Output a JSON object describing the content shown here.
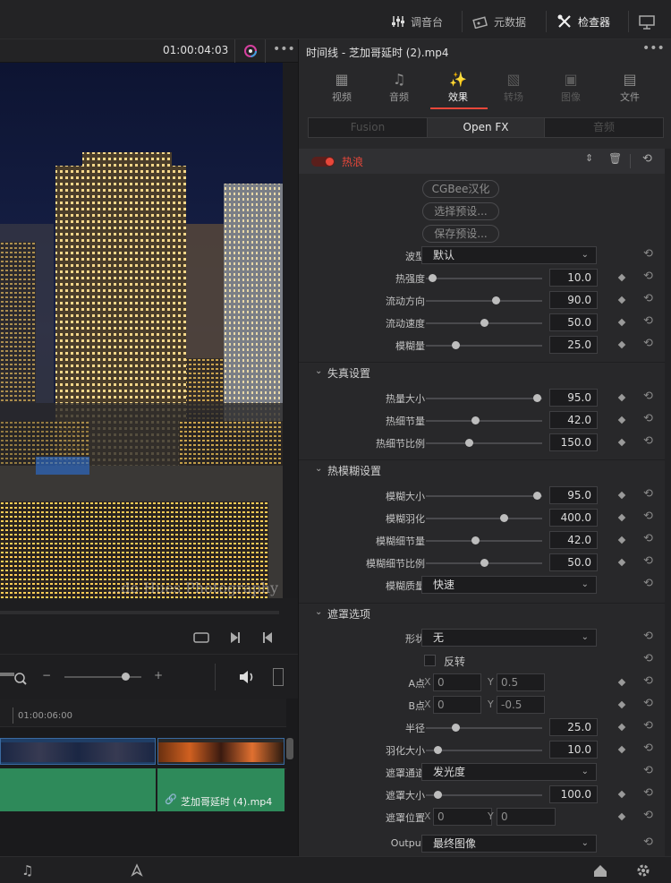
{
  "topbar": {
    "mixer": "调音台",
    "metadata": "元数据",
    "inspector": "检查器"
  },
  "viewer": {
    "timecode": "01:00:04:03",
    "watermark": "...do Hues Photography"
  },
  "timeline": {
    "ruler_time": "01:00:06:00",
    "audio_clip": "芝加哥延时 (4).mp4"
  },
  "inspector": {
    "title": "时间线 - 芝加哥延时 (2).mp4",
    "tabs": [
      {
        "label": "视频",
        "icon": "video-icon"
      },
      {
        "label": "音频",
        "icon": "music-icon"
      },
      {
        "label": "效果",
        "icon": "magic-wand-icon"
      },
      {
        "label": "转场",
        "icon": "transition-icon"
      },
      {
        "label": "图像",
        "icon": "image-icon"
      },
      {
        "label": "文件",
        "icon": "file-icon"
      }
    ],
    "subtabs": [
      "Fusion",
      "Open FX",
      "音频"
    ],
    "effect_name": "热浪",
    "buttons": [
      "CGBee汉化",
      "选择预设...",
      "保存预设..."
    ],
    "params": {
      "wave_type": {
        "label": "波型",
        "value": "默认"
      },
      "heat_strength": {
        "label": "热强度",
        "value": "10.0",
        "fraction": 0.05
      },
      "flow_direction": {
        "label": "流动方向",
        "value": "90.0",
        "fraction": 0.6
      },
      "flow_speed": {
        "label": "流动速度",
        "value": "50.0",
        "fraction": 0.5
      },
      "blur_amount": {
        "label": "模糊量",
        "value": "25.0",
        "fraction": 0.25
      }
    },
    "distortion": {
      "title": "失真设置",
      "heat_size": {
        "label": "热量大小",
        "value": "95.0",
        "fraction": 0.95
      },
      "heat_detail": {
        "label": "热细节量",
        "value": "42.0",
        "fraction": 0.42
      },
      "heat_detail_ratio": {
        "label": "热细节比例",
        "value": "150.0",
        "fraction": 0.37
      }
    },
    "heat_blur": {
      "title": "热模糊设置",
      "blur_size": {
        "label": "模糊大小",
        "value": "95.0",
        "fraction": 0.95
      },
      "blur_feather": {
        "label": "模糊羽化",
        "value": "400.0",
        "fraction": 0.67
      },
      "blur_detail": {
        "label": "模糊细节量",
        "value": "42.0",
        "fraction": 0.42
      },
      "blur_detail_ratio": {
        "label": "模糊细节比例",
        "value": "50.0",
        "fraction": 0.5
      },
      "blur_quality": {
        "label": "模糊质量",
        "value": "快速"
      }
    },
    "mask": {
      "title": "遮罩选项",
      "shape": {
        "label": "形状",
        "value": "无"
      },
      "invert": {
        "label": "反转"
      },
      "point_a": {
        "label": "A点",
        "x": "0",
        "y": "0.5"
      },
      "point_b": {
        "label": "B点",
        "x": "0",
        "y": "-0.5"
      },
      "radius": {
        "label": "半径",
        "value": "25.0",
        "fraction": 0.25
      },
      "feather_size": {
        "label": "羽化大小",
        "value": "10.0",
        "fraction": 0.1
      },
      "mask_channel": {
        "label": "遮罩通道",
        "value": "发光度"
      },
      "mask_size": {
        "label": "遮罩大小",
        "value": "100.0",
        "fraction": 0.1
      },
      "mask_position": {
        "label": "遮罩位置",
        "x": "0",
        "y": "0"
      },
      "output": {
        "label": "Output",
        "value": "最终图像"
      }
    }
  },
  "colors": {
    "accent": "#e8473a",
    "panel": "#28282a",
    "field": "#1c1c1e"
  }
}
